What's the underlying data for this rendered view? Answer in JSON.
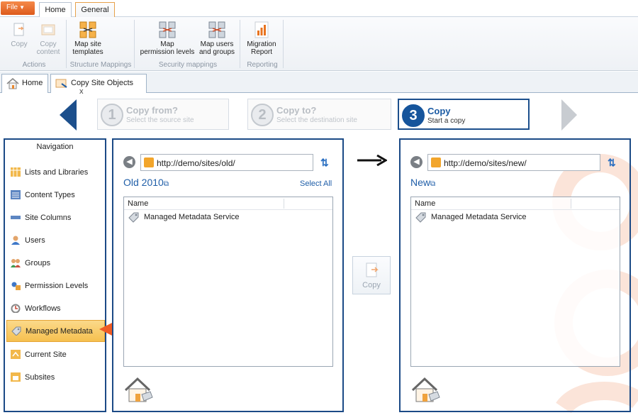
{
  "ribbon": {
    "file_tab": "File",
    "tabs": [
      "Home",
      "General"
    ],
    "groups": [
      {
        "label": "Actions",
        "buttons": [
          "Copy",
          "Copy\ncontent"
        ]
      },
      {
        "label": "Structure Mappings",
        "buttons": [
          "Map site\ntemplates"
        ]
      },
      {
        "label": "Security mappings",
        "buttons": [
          "Map\npermission levels",
          "Map users\nand groups"
        ]
      },
      {
        "label": "Reporting",
        "buttons": [
          "Migration\nReport"
        ]
      }
    ]
  },
  "doc_tabs": [
    {
      "label": "Home",
      "icon": "house-icon"
    },
    {
      "label": "Copy Site Objects",
      "icon": "copy-objects-icon",
      "close": "x"
    }
  ],
  "wizard": {
    "steps": [
      {
        "num": "1",
        "title": "Copy from?",
        "subtitle": "Select the source site",
        "active": false
      },
      {
        "num": "2",
        "title": "Copy to?",
        "subtitle": "Select the destination site",
        "active": false
      },
      {
        "num": "3",
        "title": "Copy",
        "subtitle": "Start a copy",
        "active": true
      }
    ]
  },
  "navigation": {
    "title": "Navigation",
    "items": [
      {
        "label": "Lists and Libraries",
        "icon": "lists-icon"
      },
      {
        "label": "Content Types",
        "icon": "content-types-icon"
      },
      {
        "label": "Site Columns",
        "icon": "site-columns-icon"
      },
      {
        "label": "Users",
        "icon": "user-icon"
      },
      {
        "label": "Groups",
        "icon": "groups-icon"
      },
      {
        "label": "Permission Levels",
        "icon": "permission-icon"
      },
      {
        "label": "Workflows",
        "icon": "workflow-icon"
      },
      {
        "label": "Managed Metadata",
        "icon": "metadata-icon",
        "selected": true
      },
      {
        "label": "Current Site",
        "icon": "current-site-icon"
      },
      {
        "label": "Subsites",
        "icon": "subsites-icon"
      }
    ]
  },
  "source": {
    "url": "http://demo/sites/old/",
    "site_title": "Old 2010",
    "select_all": "Select All",
    "column": "Name",
    "rows": [
      "Managed Metadata Service"
    ]
  },
  "destination": {
    "url": "http://demo/sites/new/",
    "site_title": "New",
    "column": "Name",
    "rows": [
      "Managed Metadata Service"
    ]
  },
  "copy_button": "Copy",
  "colors": {
    "accent": "#1b4a86",
    "link": "#1f5ea8",
    "selected": "#f6c04f",
    "callout_arrow": "#ef5b24"
  }
}
